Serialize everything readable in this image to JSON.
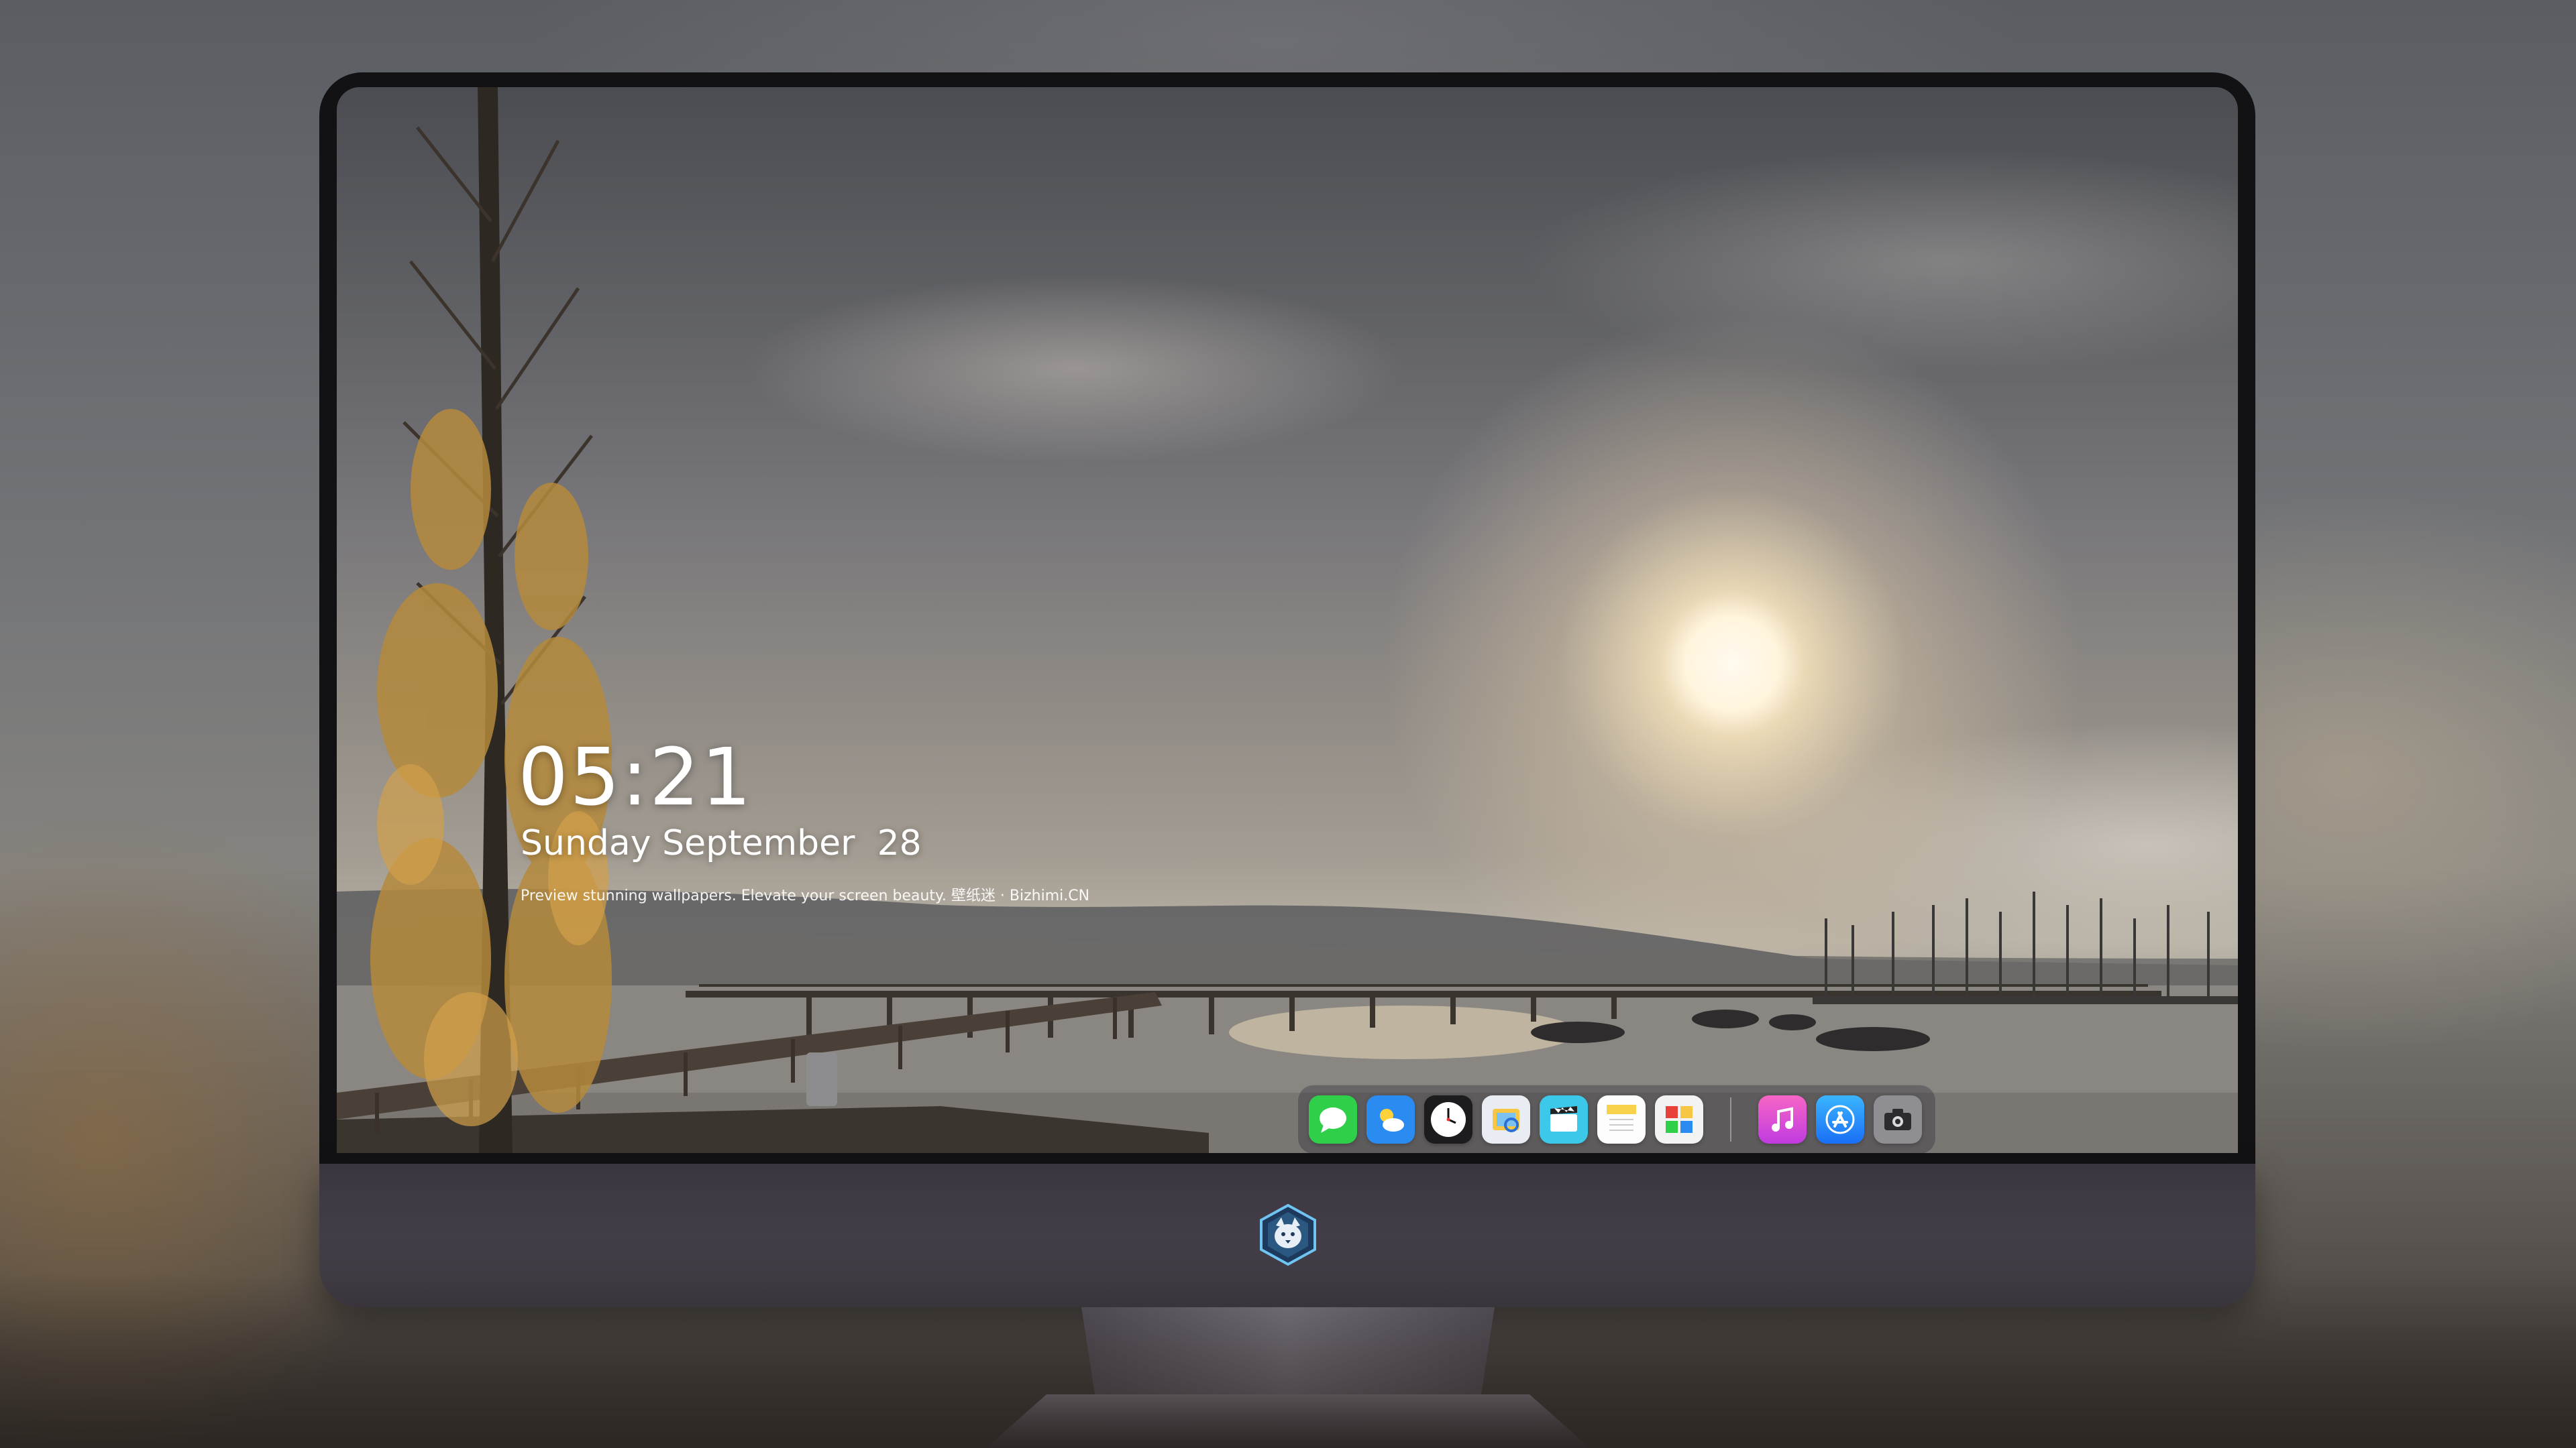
{
  "lock_screen": {
    "time": "05:21",
    "date": "Sunday September  28",
    "tagline": "Preview stunning wallpapers. Elevate your screen beauty. 壁纸迷 · Bizhimi.CN"
  },
  "dock": {
    "apps": [
      {
        "icon": "messages-icon",
        "color": "#2fcf4a"
      },
      {
        "icon": "weather-icon",
        "color": "#2a8cf0"
      },
      {
        "icon": "clock-icon",
        "color": "#ffffff"
      },
      {
        "icon": "preview-icon",
        "color": "#f6c644"
      },
      {
        "icon": "clips-icon",
        "color": "#3cc8e8"
      },
      {
        "icon": "notes-icon",
        "color": "#f7d24a"
      },
      {
        "icon": "photo-booth-icon",
        "color": "#e8413a"
      },
      {
        "icon": "music-icon",
        "color": "#e23bd8"
      },
      {
        "icon": "app-store-icon",
        "color": "#1a8ff5"
      },
      {
        "icon": "camera-icon",
        "color": "#8e8e93"
      }
    ]
  },
  "monitor": {
    "logo_icon": "wolf-badge-icon"
  }
}
